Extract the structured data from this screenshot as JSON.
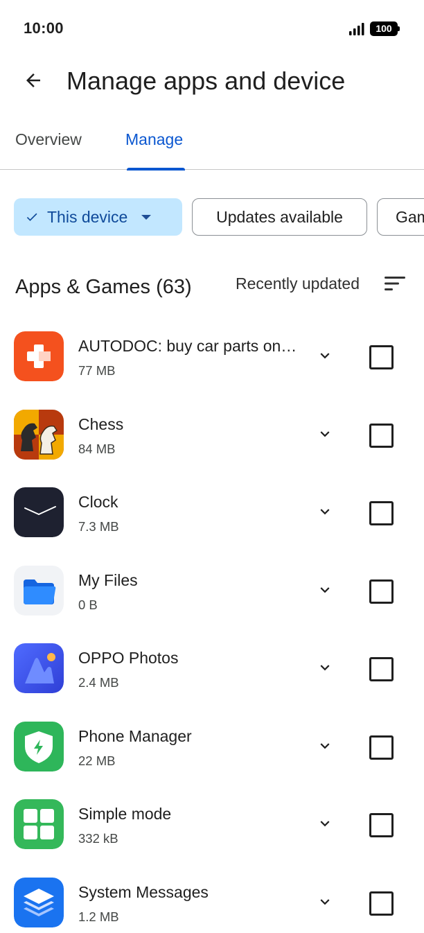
{
  "status_bar": {
    "time": "10:00",
    "battery": "100"
  },
  "header": {
    "title": "Manage apps and device",
    "back_icon": "arrow-left-icon"
  },
  "tabs": [
    {
      "label": "Overview",
      "selected": false
    },
    {
      "label": "Manage",
      "selected": true
    }
  ],
  "filters": {
    "device": {
      "label": "This device",
      "selected": true
    },
    "updates": {
      "label": "Updates available"
    },
    "games": {
      "label": "Games"
    }
  },
  "section": {
    "title": "Apps & Games (63)",
    "sort_label": "Recently updated"
  },
  "apps": [
    {
      "name": "AUTODOC: buy car parts online",
      "size": "77 MB",
      "icon": "autodoc-app-icon"
    },
    {
      "name": "Chess",
      "size": "84 MB",
      "icon": "chess-app-icon"
    },
    {
      "name": "Clock",
      "size": "7.3 MB",
      "icon": "clock-app-icon"
    },
    {
      "name": "My Files",
      "size": "0 B",
      "icon": "my-files-app-icon"
    },
    {
      "name": "OPPO Photos",
      "size": "2.4 MB",
      "icon": "oppo-photos-app-icon"
    },
    {
      "name": "Phone Manager",
      "size": "22 MB",
      "icon": "phone-manager-app-icon"
    },
    {
      "name": "Simple mode",
      "size": "332 kB",
      "icon": "simple-mode-app-icon"
    },
    {
      "name": "System Messages",
      "size": "1.2 MB",
      "icon": "system-messages-app-icon"
    }
  ],
  "colors": {
    "accent": "#0b57d0",
    "chip_selected_bg": "#c2e7ff",
    "text_primary": "#1f1f1f",
    "text_secondary": "#444746"
  }
}
